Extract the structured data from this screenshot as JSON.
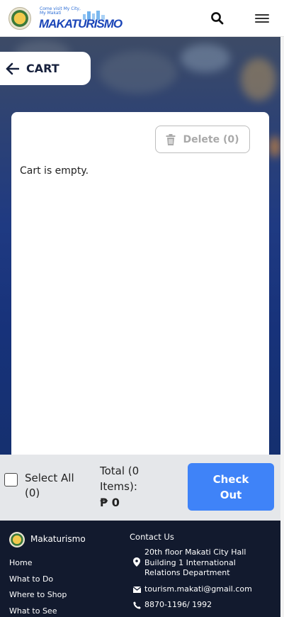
{
  "header": {
    "logo_tagline": "Come visit My City, My Makati",
    "logo_text": "MAKATURISMO",
    "search_icon": "search-icon",
    "menu_icon": "hamburger-menu-icon"
  },
  "cart": {
    "title": "CART",
    "back_icon": "arrow-left-icon",
    "delete_label": "Delete (0)",
    "delete_icon": "trash-icon",
    "empty_message": "Cart is empty."
  },
  "checkout": {
    "select_all_label": "Select All (0)",
    "total_label": "Total (0 Items):",
    "total_amount": "₱ 0",
    "checkout_label": "Check Out",
    "accent_color": "#3f83f8"
  },
  "footer": {
    "brand": "Makaturismo",
    "links": [
      "Home",
      "What to Do",
      "Where to Shop",
      "What to See"
    ],
    "contact_title": "Contact Us",
    "address": "20th floor Makati City Hall Building 1 International Relations Department",
    "email": "tourism.makati@gmail.com",
    "phone": "8870-1196/ 1992",
    "background_color": "#121a2e"
  }
}
